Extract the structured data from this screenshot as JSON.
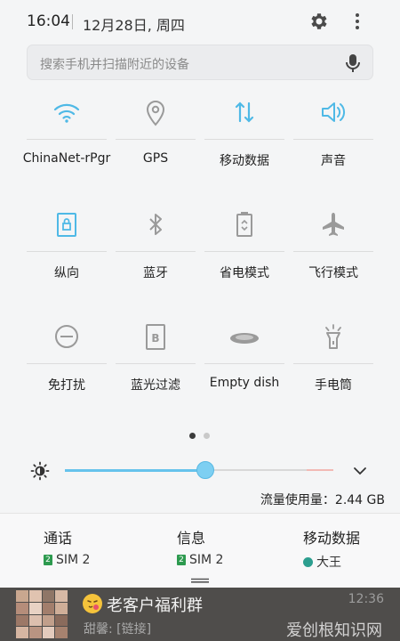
{
  "status": {
    "time": "16:04",
    "date": "12月28日, 周四"
  },
  "search": {
    "placeholder": "搜索手机并扫描附近的设备"
  },
  "tiles": [
    {
      "label": "ChinaNet-rPgr",
      "icon": "wifi-icon",
      "active": true
    },
    {
      "label": "GPS",
      "icon": "location-icon",
      "active": false
    },
    {
      "label": "移动数据",
      "icon": "data-arrows-icon",
      "active": true
    },
    {
      "label": "声音",
      "icon": "speaker-icon",
      "active": true
    },
    {
      "label": "纵向",
      "icon": "rotation-lock-icon",
      "active": true
    },
    {
      "label": "蓝牙",
      "icon": "bluetooth-icon",
      "active": false
    },
    {
      "label": "省电模式",
      "icon": "battery-saver-icon",
      "active": false
    },
    {
      "label": "飞行模式",
      "icon": "airplane-icon",
      "active": false
    },
    {
      "label": "免打扰",
      "icon": "do-not-disturb-icon",
      "active": false
    },
    {
      "label": "蓝光过滤",
      "icon": "blue-light-filter-icon",
      "active": false
    },
    {
      "label": "Empty dish",
      "icon": "dish-icon",
      "active": false
    },
    {
      "label": "手电筒",
      "icon": "flashlight-icon",
      "active": false
    }
  ],
  "pager": {
    "current_page": 1,
    "page_count": 2
  },
  "brightness": {
    "level": 0.53
  },
  "data_usage": "流量使用量：2.44 GB",
  "sim": [
    {
      "title": "通话",
      "sub": "SIM 2",
      "badge": "2"
    },
    {
      "title": "信息",
      "sub": "SIM 2",
      "badge": "2"
    },
    {
      "title": "移动数据",
      "sub": "大王",
      "badge": ""
    }
  ],
  "notification": {
    "title": "老客户福利群",
    "sub": "甜馨: [链接]",
    "time": "12:36",
    "watermark": "爱创根知识网"
  },
  "colors": {
    "accent": "#4fb9e6",
    "inactive": "#9a9a9a",
    "sim_green": "#2d9a4f"
  }
}
